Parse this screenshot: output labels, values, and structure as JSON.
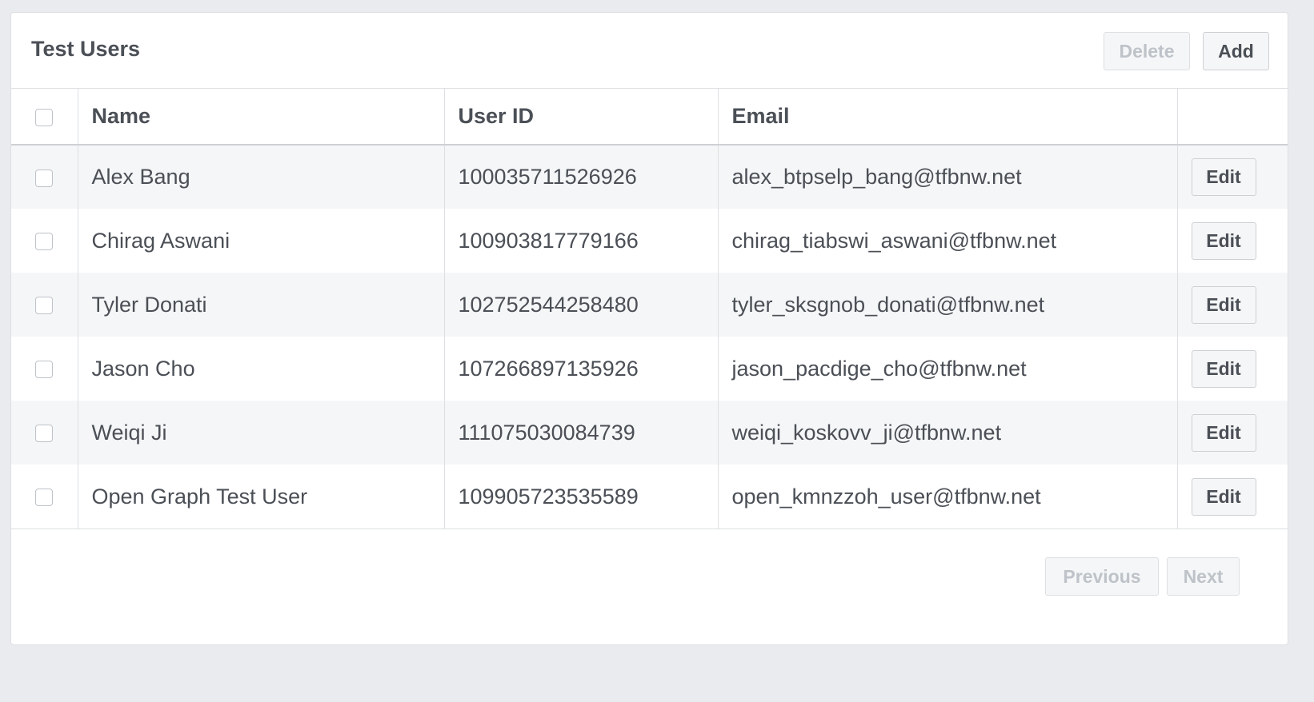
{
  "panel": {
    "title": "Test Users",
    "delete_label": "Delete",
    "add_label": "Add"
  },
  "table": {
    "columns": [
      "Name",
      "User ID",
      "Email"
    ],
    "rows": [
      {
        "name": "Alex Bang",
        "user_id": "100035711526926",
        "email": "alex_btpselp_bang@tfbnw.net",
        "action": "Edit"
      },
      {
        "name": "Chirag Aswani",
        "user_id": "100903817779166",
        "email": "chirag_tiabswi_aswani@tfbnw.net",
        "action": "Edit"
      },
      {
        "name": "Tyler Donati",
        "user_id": "102752544258480",
        "email": "tyler_sksgnob_donati@tfbnw.net",
        "action": "Edit"
      },
      {
        "name": "Jason Cho",
        "user_id": "107266897135926",
        "email": "jason_pacdige_cho@tfbnw.net",
        "action": "Edit"
      },
      {
        "name": "Weiqi Ji",
        "user_id": "111075030084739",
        "email": "weiqi_koskovv_ji@tfbnw.net",
        "action": "Edit"
      },
      {
        "name": "Open Graph Test User",
        "user_id": "109905723535589",
        "email": "open_kmnzzoh_user@tfbnw.net",
        "action": "Edit"
      }
    ]
  },
  "pagination": {
    "previous_label": "Previous",
    "next_label": "Next"
  }
}
